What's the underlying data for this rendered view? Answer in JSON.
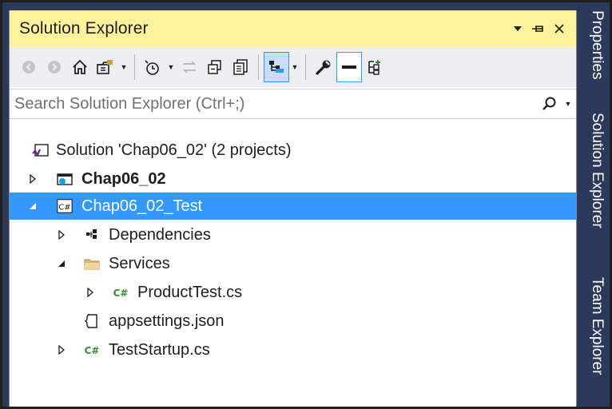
{
  "panel": {
    "title": "Solution Explorer",
    "search_placeholder": "Search Solution Explorer (Ctrl+;)"
  },
  "toolbar": {
    "icons": [
      "back-icon",
      "forward-icon",
      "home-icon",
      "switch-views-icon",
      "pending-changes-filter-icon",
      "sync-with-document-icon",
      "collapse-all-icon",
      "show-all-files-icon",
      "preview-selected-items-icon",
      "properties-icon",
      "active-document-icon",
      "new-solution-explorer-view-icon"
    ]
  },
  "tree": {
    "solution": "Solution 'Chap06_02' (2 projects)",
    "project1": "Chap06_02",
    "project2": "Chap06_02_Test",
    "dependencies": "Dependencies",
    "services": "Services",
    "producttest": "ProductTest.cs",
    "appsettings": "appsettings.json",
    "teststartup": "TestStartup.cs"
  },
  "sidetabs": {
    "properties": "Properties",
    "solution_explorer": "Solution Explorer",
    "team_explorer": "Team Explorer"
  },
  "colors": {
    "title_bar": "#fff29d",
    "selection": "#3399ff",
    "side_tabs": "#2b3a5a",
    "csharp_green": "#388a34"
  }
}
